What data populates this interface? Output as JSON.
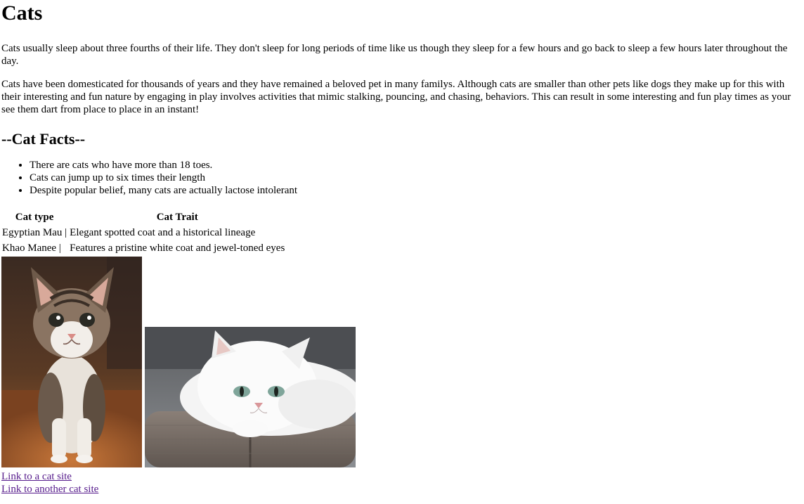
{
  "page": {
    "title": "Cats",
    "paragraphs": [
      "Cats usually sleep about three fourths of their life. They don't sleep for long periods of time like us though they sleep for a few hours and go back to sleep a few hours later throughout the day.",
      "Cats have been domesticated for thousands of years and they have remained a beloved pet in many familys. Although cats are smaller than other pets like dogs they make up for this with their interesting and fun nature by engaging in play involves activities that mimic stalking, pouncing, and chasing, behaviors. This can result in some interesting and fun play times as your see them dart from place to place in an instant!"
    ],
    "facts_heading": "--Cat Facts--",
    "facts": [
      "There are cats who have more than 18 toes.",
      "Cats can jump up to six times their length",
      "Despite popular belief, many cats are actually lactose intolerant"
    ]
  },
  "table": {
    "headers": [
      "Cat type",
      "Cat Trait"
    ],
    "rows": [
      [
        "Egyptian Mau |",
        "Elegant spotted coat and a historical lineage"
      ],
      [
        "Khao Manee |",
        "Features a pristine white coat and jewel-toned eyes"
      ]
    ]
  },
  "images": [
    {
      "icon": "kitten-photo"
    },
    {
      "icon": "persian-cat-photo"
    }
  ],
  "links": [
    "Link to a cat site",
    "Link to another cat site"
  ],
  "colors": {
    "visited_link": "#551a8b"
  }
}
